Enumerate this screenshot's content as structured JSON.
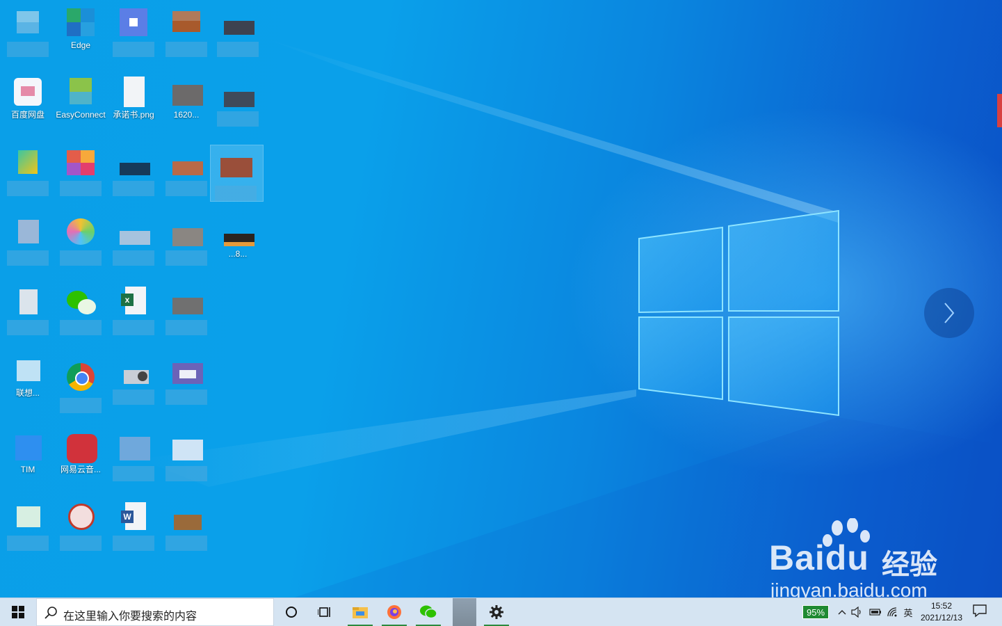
{
  "desktop": {
    "icons": [
      {
        "id": "r1c1",
        "label": ""
      },
      {
        "id": "r1c2",
        "label": "Edge"
      },
      {
        "id": "r1c3",
        "label": ""
      },
      {
        "id": "r1c4",
        "label": ""
      },
      {
        "id": "r1c5",
        "label": ""
      },
      {
        "id": "r2c1",
        "label": "百度网盘"
      },
      {
        "id": "r2c2",
        "label": "EasyConnect"
      },
      {
        "id": "r2c3",
        "label": "承诺书.png"
      },
      {
        "id": "r2c4",
        "label": "1620..."
      },
      {
        "id": "r2c5",
        "label": ""
      },
      {
        "id": "r4c5",
        "label": "...8..."
      },
      {
        "id": "r6c1",
        "label": "联想..."
      },
      {
        "id": "r7c1",
        "label": "TIM"
      },
      {
        "id": "r7c2",
        "label": "网易云音..."
      }
    ]
  },
  "colors": {
    "wallpaper_light": "#0aa0ea",
    "wallpaper_dark": "#0a4fc4",
    "taskbar": "#d5e4f2",
    "battery_green": "#1f8a32",
    "active_underline": "#2b8a3e"
  },
  "watermark": {
    "brand": "Baidu",
    "suffix": "经验",
    "url": "jingyan.baidu.com"
  },
  "taskbar": {
    "start_icon": "windows-logo-icon",
    "search_placeholder": "在这里输入你要搜索的内容",
    "buttons": [
      {
        "name": "cortana-icon"
      },
      {
        "name": "task-view-icon"
      },
      {
        "name": "file-explorer-icon"
      },
      {
        "name": "firefox-icon"
      },
      {
        "name": "wechat-icon"
      },
      {
        "name": "app-icon"
      },
      {
        "name": "settings-gear-icon"
      }
    ],
    "tray": {
      "battery_percent": "95%",
      "ime": "英",
      "time": "15:52",
      "date": "2021/12/13"
    }
  }
}
